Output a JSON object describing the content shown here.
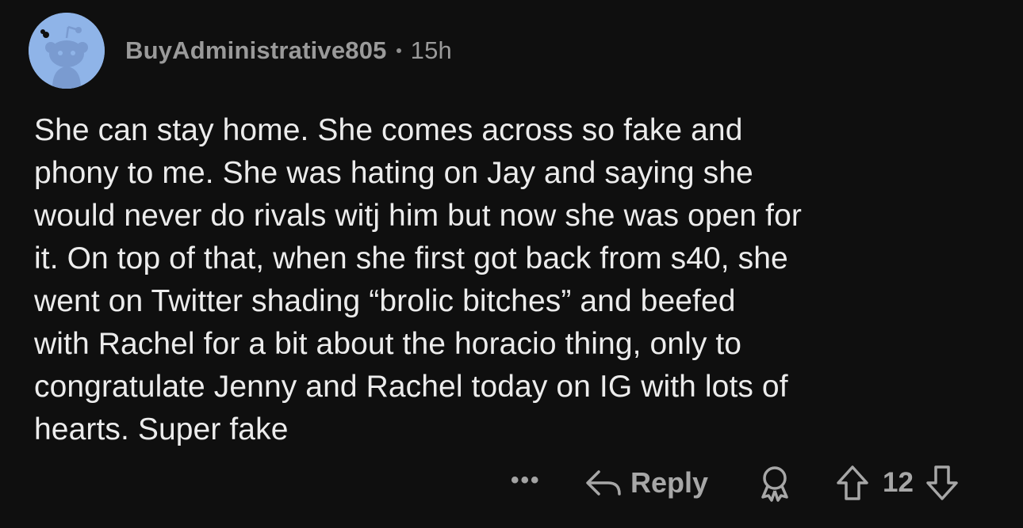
{
  "comment": {
    "username": "BuyAdministrative805",
    "age": "15h",
    "text": "She can stay home. She comes across so fake and\nphony to me. She was hating on Jay and saying she\nwould never do rivals witj him but now she was open for\nit. On top of that, when she first got back from s40, she\nwent on Twitter shading “brolic bitches” and beefed\nwith Rachel for a bit about the horacio thing, only to\ncongratulate Jenny and Rachel today on IG with lots of\nhearts. Super fake"
  },
  "actions": {
    "more_label": "•••",
    "reply_label": "Reply",
    "score": "12"
  },
  "icons": {
    "avatar": "snoo-avatar-icon",
    "reply": "reply-arrow-icon",
    "award": "award-icon",
    "upvote": "upvote-arrow-icon",
    "downvote": "downvote-arrow-icon"
  },
  "colors": {
    "background": "#0f0f0f",
    "text": "#ececec",
    "muted": "#9a9a9a",
    "avatar_bg": "#8fb4e8"
  }
}
